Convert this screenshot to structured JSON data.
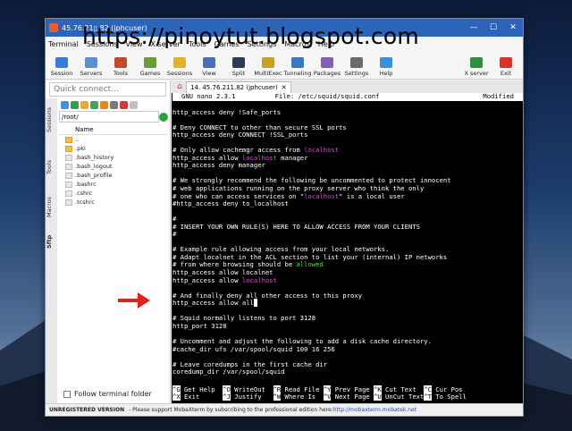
{
  "overlay_text": "https://pinoytut.blogspot.com",
  "window": {
    "title": "45.76.21▯.82 (jphcuser)",
    "controls": [
      "—",
      "☐",
      "✕"
    ]
  },
  "menu": [
    "Terminal",
    "Sessions",
    "View",
    "X server",
    "Tools",
    "Games",
    "Settings",
    "Macros",
    "Help"
  ],
  "toolbar": {
    "items": [
      {
        "label": "Session",
        "color": "#3a7bd5"
      },
      {
        "label": "Servers",
        "color": "#5b8fd0"
      },
      {
        "label": "Tools",
        "color": "#c44a2c"
      },
      {
        "label": "Games",
        "color": "#6c9c3a"
      },
      {
        "label": "Sessions",
        "color": "#e0b12f"
      },
      {
        "label": "View",
        "color": "#4b6fb5"
      },
      {
        "label": "Split",
        "color": "#2f3b55"
      },
      {
        "label": "MultiExec",
        "color": "#c9a02a"
      },
      {
        "label": "Tunneling",
        "color": "#3a78c2"
      },
      {
        "label": "Packages",
        "color": "#8560b0"
      },
      {
        "label": "Settings",
        "color": "#6a6a6a"
      },
      {
        "label": "Help",
        "color": "#3c8ed8"
      }
    ],
    "right_items": [
      {
        "label": "X server",
        "color": "#2f8f3c"
      },
      {
        "label": "Exit",
        "color": "#d9342b"
      }
    ]
  },
  "left_panel": {
    "quick_connect_placeholder": "Quick connect...",
    "vertical_tabs": [
      "Sessions",
      "Tools",
      "Macros",
      "Sftp"
    ],
    "path": "/root/",
    "column_header": "Name",
    "files": [
      {
        "name": "..",
        "type": "folder"
      },
      {
        "name": ".pki",
        "type": "folder"
      },
      {
        "name": ".bash_history",
        "type": "file"
      },
      {
        "name": ".bash_logout",
        "type": "file"
      },
      {
        "name": ".bash_profile",
        "type": "file"
      },
      {
        "name": ".bashrc",
        "type": "file"
      },
      {
        "name": ".cshrc",
        "type": "file"
      },
      {
        "name": ".tcshrc",
        "type": "file"
      }
    ],
    "follow_label": "Follow terminal folder"
  },
  "session_tab": {
    "label": "14. 45.76.211.82 (jphcuser)",
    "close": "✕"
  },
  "nano": {
    "version": "GNU nano 2.3.1",
    "file": "File: /etc/squid/squid.conf",
    "status": "Modified"
  },
  "terminal_lines": [
    [
      {
        "t": ""
      }
    ],
    [
      {
        "t": "http_access deny !Safe_ports"
      }
    ],
    [
      {
        "t": ""
      }
    ],
    [
      {
        "t": "# Deny CONNECT to other than secure SSL ports"
      }
    ],
    [
      {
        "t": "http_access deny CONNECT !SSL_ports"
      }
    ],
    [
      {
        "t": ""
      }
    ],
    [
      {
        "t": "# Only allow cachemgr access from "
      },
      {
        "t": "localhost",
        "c": "hl"
      }
    ],
    [
      {
        "t": "http_access allow "
      },
      {
        "t": "localhost",
        "c": "hl"
      },
      {
        "t": " manager"
      }
    ],
    [
      {
        "t": "http_access deny manager"
      }
    ],
    [
      {
        "t": ""
      }
    ],
    [
      {
        "t": "# We strongly recommend the following be uncommented to protect innocent"
      }
    ],
    [
      {
        "t": "# web applications running on the proxy server who think the only"
      }
    ],
    [
      {
        "t": "# one who can access services on \""
      },
      {
        "t": "localhost",
        "c": "hl"
      },
      {
        "t": "\" is a local user"
      }
    ],
    [
      {
        "t": "#http_access deny to_localhost"
      }
    ],
    [
      {
        "t": ""
      }
    ],
    [
      {
        "t": "#"
      }
    ],
    [
      {
        "t": "# INSERT YOUR OWN RULE(S) HERE TO ALLOW ACCESS FROM YOUR CLIENTS"
      }
    ],
    [
      {
        "t": "#"
      }
    ],
    [
      {
        "t": ""
      }
    ],
    [
      {
        "t": "# Example rule allowing access from your local networks."
      }
    ],
    [
      {
        "t": "# Adapt localnet in the ACL section to list your (internal) IP networks"
      }
    ],
    [
      {
        "t": "# from where browsing should be "
      },
      {
        "t": "allowed",
        "c": "hl2"
      }
    ],
    [
      {
        "t": "http_access allow localnet"
      }
    ],
    [
      {
        "t": "http_access allow "
      },
      {
        "t": "localhost",
        "c": "hl"
      }
    ],
    [
      {
        "t": ""
      }
    ],
    [
      {
        "t": "# And finally deny all other access to this proxy"
      }
    ],
    [
      {
        "t": "http_access allow all"
      },
      {
        "t": " ",
        "c": "cursor"
      }
    ],
    [
      {
        "t": ""
      }
    ],
    [
      {
        "t": "# Squid normally listens to port 3128"
      }
    ],
    [
      {
        "t": "http_port 3128"
      }
    ],
    [
      {
        "t": ""
      }
    ],
    [
      {
        "t": "# Uncomment and adjust the following to add a disk cache directory."
      }
    ],
    [
      {
        "t": "#cache_dir ufs /var/spool/squid 100 16 256"
      }
    ],
    [
      {
        "t": ""
      }
    ],
    [
      {
        "t": "# Leave coredumps in the first cache dir"
      }
    ],
    [
      {
        "t": "coredump_dir /var/spool/squid"
      }
    ]
  ],
  "nano_shortcuts": [
    [
      {
        "k": "^G",
        "l": "Get Help"
      },
      {
        "k": "^O",
        "l": "WriteOut"
      },
      {
        "k": "^R",
        "l": "Read File"
      },
      {
        "k": "^Y",
        "l": "Prev Page"
      },
      {
        "k": "^K",
        "l": "Cut Text"
      },
      {
        "k": "^C",
        "l": "Cur Pos"
      }
    ],
    [
      {
        "k": "^X",
        "l": "Exit"
      },
      {
        "k": "^J",
        "l": "Justify"
      },
      {
        "k": "^W",
        "l": "Where Is"
      },
      {
        "k": "^V",
        "l": "Next Page"
      },
      {
        "k": "^U",
        "l": "UnCut Text"
      },
      {
        "k": "^T",
        "l": "To Spell"
      }
    ]
  ],
  "statusbar": {
    "bold": "UNREGISTERED VERSION",
    "text": " -  Please support MobaXterm by subscribing to the professional edition here: ",
    "link": "http://mobaxterm.mobatek.net"
  },
  "colors": {
    "arrow": "#e0231b",
    "titlebar": "#2b64b8"
  }
}
